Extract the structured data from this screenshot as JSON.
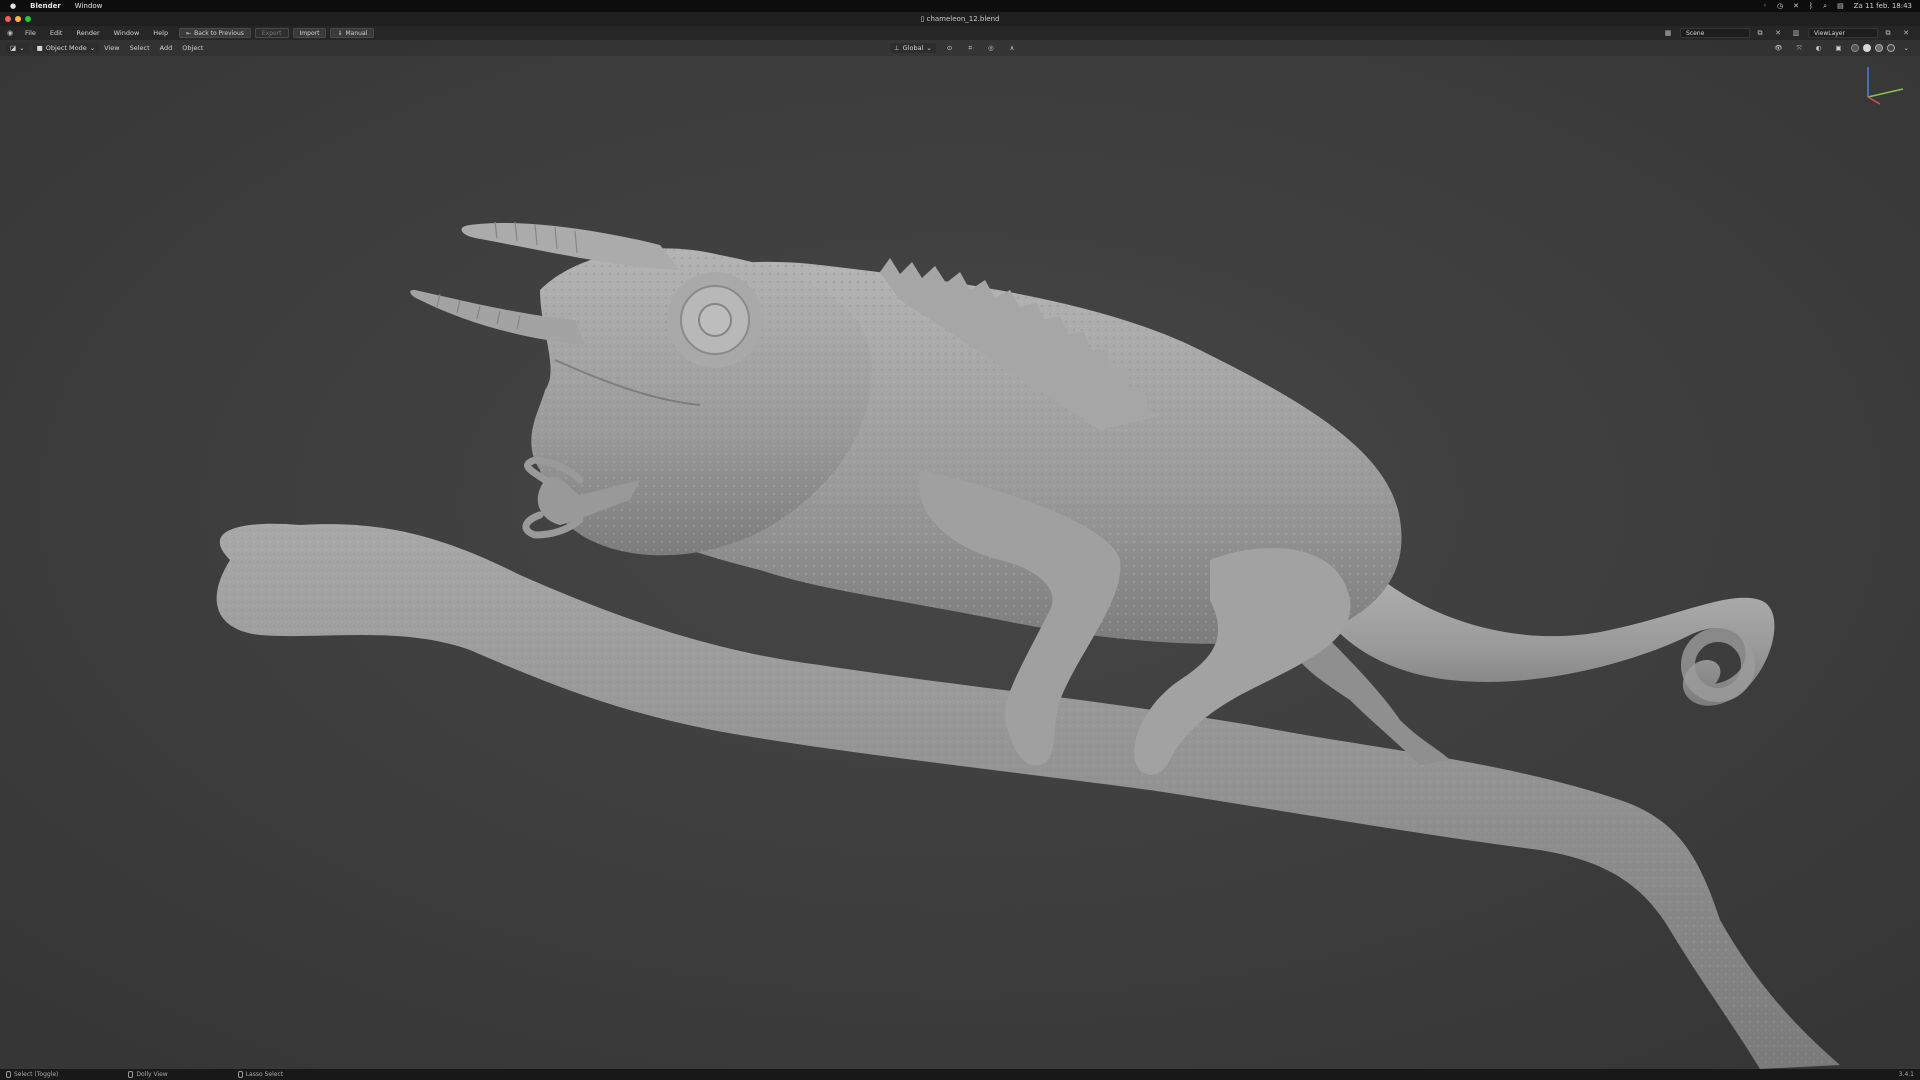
{
  "mac_menubar": {
    "app": "Blender",
    "menu": "Window",
    "datetime": "Za 11 feb. 18:43"
  },
  "window": {
    "title": "chameleon_12.blend"
  },
  "topbar": {
    "menus": [
      "File",
      "Edit",
      "Render",
      "Window",
      "Help"
    ],
    "back_to_previous": "Back to Previous",
    "export_label": "Export",
    "import_label": "Import",
    "manual_label": "Manual",
    "scene": "Scene",
    "view_layer": "ViewLayer"
  },
  "viewport_header": {
    "mode": "Object Mode",
    "menus": [
      "View",
      "Select",
      "Add",
      "Object"
    ],
    "orientation": "Global"
  },
  "statusbar": {
    "select": "Select (Toggle)",
    "dolly": "Dolly View",
    "lasso": "Lasso Select",
    "version": "3.4.1"
  },
  "colors": {
    "background": "#3d3d3d",
    "model": "#9c9c9c",
    "gizmo_x": "#e04a4a",
    "gizmo_y": "#8bc34a",
    "gizmo_z": "#4a7fe0"
  }
}
